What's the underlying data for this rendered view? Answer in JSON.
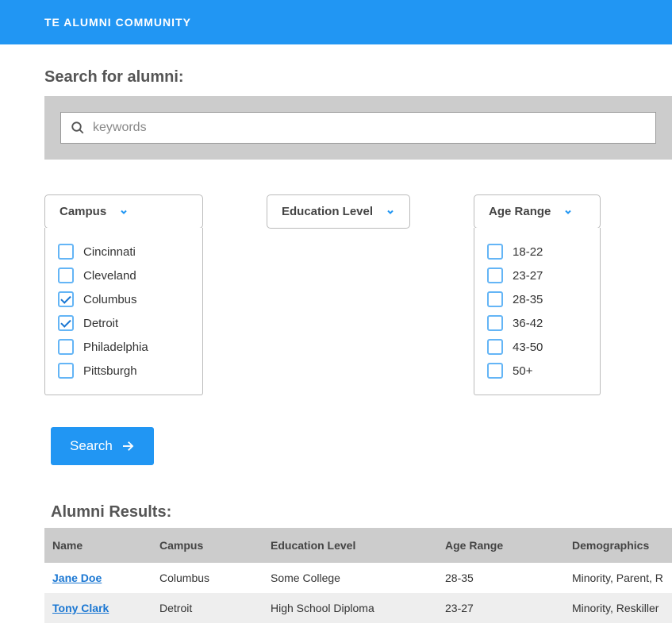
{
  "header": {
    "title": "TE   ALUMNI COMMUNITY"
  },
  "search": {
    "title": "Search for alumni:",
    "placeholder": "keywords"
  },
  "filters": {
    "campus": {
      "label": "Campus",
      "options": [
        {
          "label": "Cincinnati",
          "checked": false
        },
        {
          "label": "Cleveland",
          "checked": false
        },
        {
          "label": "Columbus",
          "checked": true
        },
        {
          "label": "Detroit",
          "checked": true
        },
        {
          "label": "Philadelphia",
          "checked": false
        },
        {
          "label": "Pittsburgh",
          "checked": false
        }
      ]
    },
    "education": {
      "label": "Education Level"
    },
    "age": {
      "label": "Age Range",
      "options": [
        {
          "label": "18-22",
          "checked": false
        },
        {
          "label": "23-27",
          "checked": false
        },
        {
          "label": "28-35",
          "checked": false
        },
        {
          "label": "36-42",
          "checked": false
        },
        {
          "label": "43-50",
          "checked": false
        },
        {
          "label": "50+",
          "checked": false
        }
      ]
    }
  },
  "search_button": "Search",
  "results": {
    "title": "Alumni Results:",
    "columns": [
      "Name",
      "Campus",
      "Education Level",
      "Age Range",
      "Demographics"
    ],
    "rows": [
      {
        "name": "Jane Doe",
        "campus": "Columbus",
        "education": "Some College",
        "age": "28-35",
        "demographics": "Minority, Parent, R"
      },
      {
        "name": "Tony Clark",
        "campus": "Detroit",
        "education": "High School Diploma",
        "age": "23-27",
        "demographics": "Minority, Reskiller"
      }
    ]
  }
}
